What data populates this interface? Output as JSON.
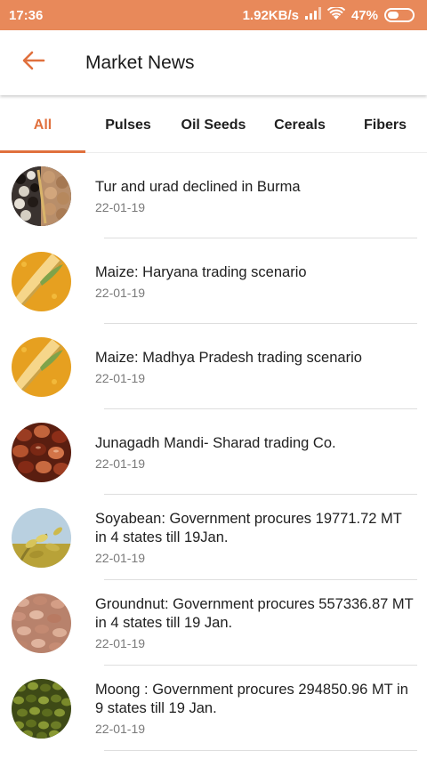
{
  "status_bar": {
    "time": "17:36",
    "net_speed": "1.92KB/s",
    "battery": "47%",
    "bg_color": "#e8895a"
  },
  "header": {
    "title": "Market News",
    "back_icon": "arrow-left-icon",
    "accent_color": "#e0703d"
  },
  "tabs": [
    {
      "label": "All",
      "active": true
    },
    {
      "label": "Pulses",
      "active": false
    },
    {
      "label": "Oil Seeds",
      "active": false
    },
    {
      "label": "Cereals",
      "active": false
    },
    {
      "label": "Fibers",
      "active": false
    }
  ],
  "news": [
    {
      "title": "Tur and urad declined in Burma",
      "date": "22-01-19",
      "thumb": "pulses-thumb"
    },
    {
      "title": "Maize: Haryana trading scenario",
      "date": "22-01-19",
      "thumb": "maize-thumb"
    },
    {
      "title": "Maize: Madhya Pradesh trading scenario",
      "date": "22-01-19",
      "thumb": "maize-thumb"
    },
    {
      "title": "Junagadh Mandi- Sharad trading Co.",
      "date": "22-01-19",
      "thumb": "beans-thumb"
    },
    {
      "title": "Soyabean: Government procures 19771.72 MT in 4 states till 19Jan.",
      "date": "22-01-19",
      "thumb": "soyabean-thumb"
    },
    {
      "title": "Groundnut: Government procures 557336.87 MT in 4 states till 19 Jan.",
      "date": "22-01-19",
      "thumb": "groundnut-thumb"
    },
    {
      "title": "Moong : Government procures 294850.96 MT in 9 states till 19  Jan.",
      "date": "22-01-19",
      "thumb": "moong-thumb"
    }
  ]
}
